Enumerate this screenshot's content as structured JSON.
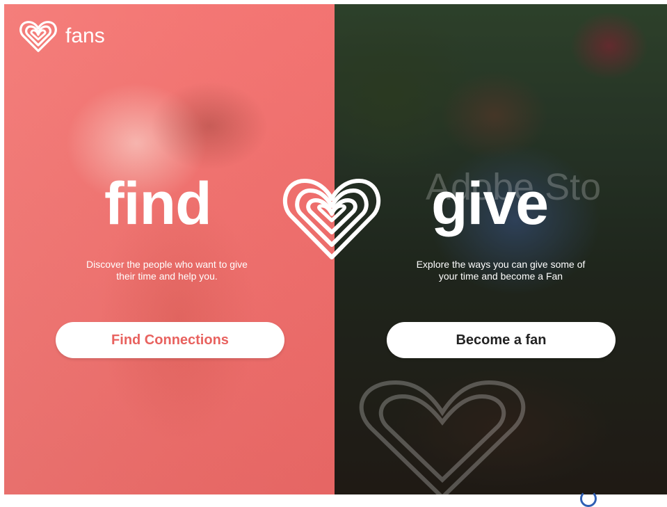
{
  "brand": {
    "name": "fans"
  },
  "find": {
    "title": "find",
    "description": "Discover the people who want to give their time and help you.",
    "button": "Find Connections"
  },
  "give": {
    "title": "give",
    "description": "Explore the ways you can give some of your time and become a Fan",
    "button": "Become a fan"
  },
  "watermark": "Adobe Sto",
  "colors": {
    "coral": "#f36f6c",
    "button_text_find": "#e8625f",
    "button_text_give": "#222222",
    "white": "#ffffff"
  },
  "icons": [
    "heart-logo-icon",
    "center-heart-icon"
  ]
}
